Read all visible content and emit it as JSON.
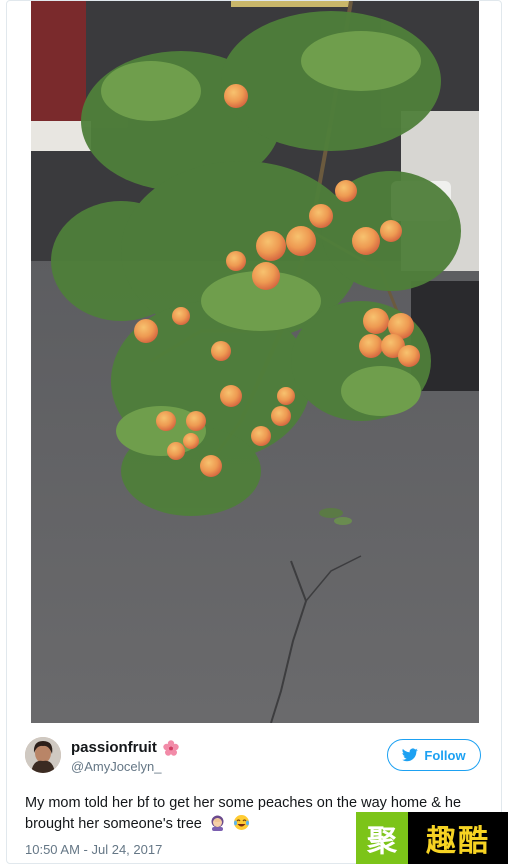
{
  "tweet": {
    "display_name": "passionfruit",
    "handle": "@AmyJocelyn_",
    "follow_label": "Follow",
    "text": "My mom told her bf to get her some peaches on the way home & he brought her someone's tree",
    "timestamp": "10:50 AM - Jul 24, 2017",
    "name_emoji": "hibiscus-flower-icon",
    "text_emojis": [
      "woman-facepalming-icon",
      "face-with-tears-of-joy-icon"
    ]
  },
  "photo": {
    "subject": "peach-tree-branch"
  },
  "watermark": {
    "left_char": "聚",
    "right_text": "趣酷"
  },
  "colors": {
    "accent": "#1da1f2",
    "secondary_text": "#657786",
    "watermark_green": "#7cc419",
    "watermark_yellow": "#f6d323"
  }
}
